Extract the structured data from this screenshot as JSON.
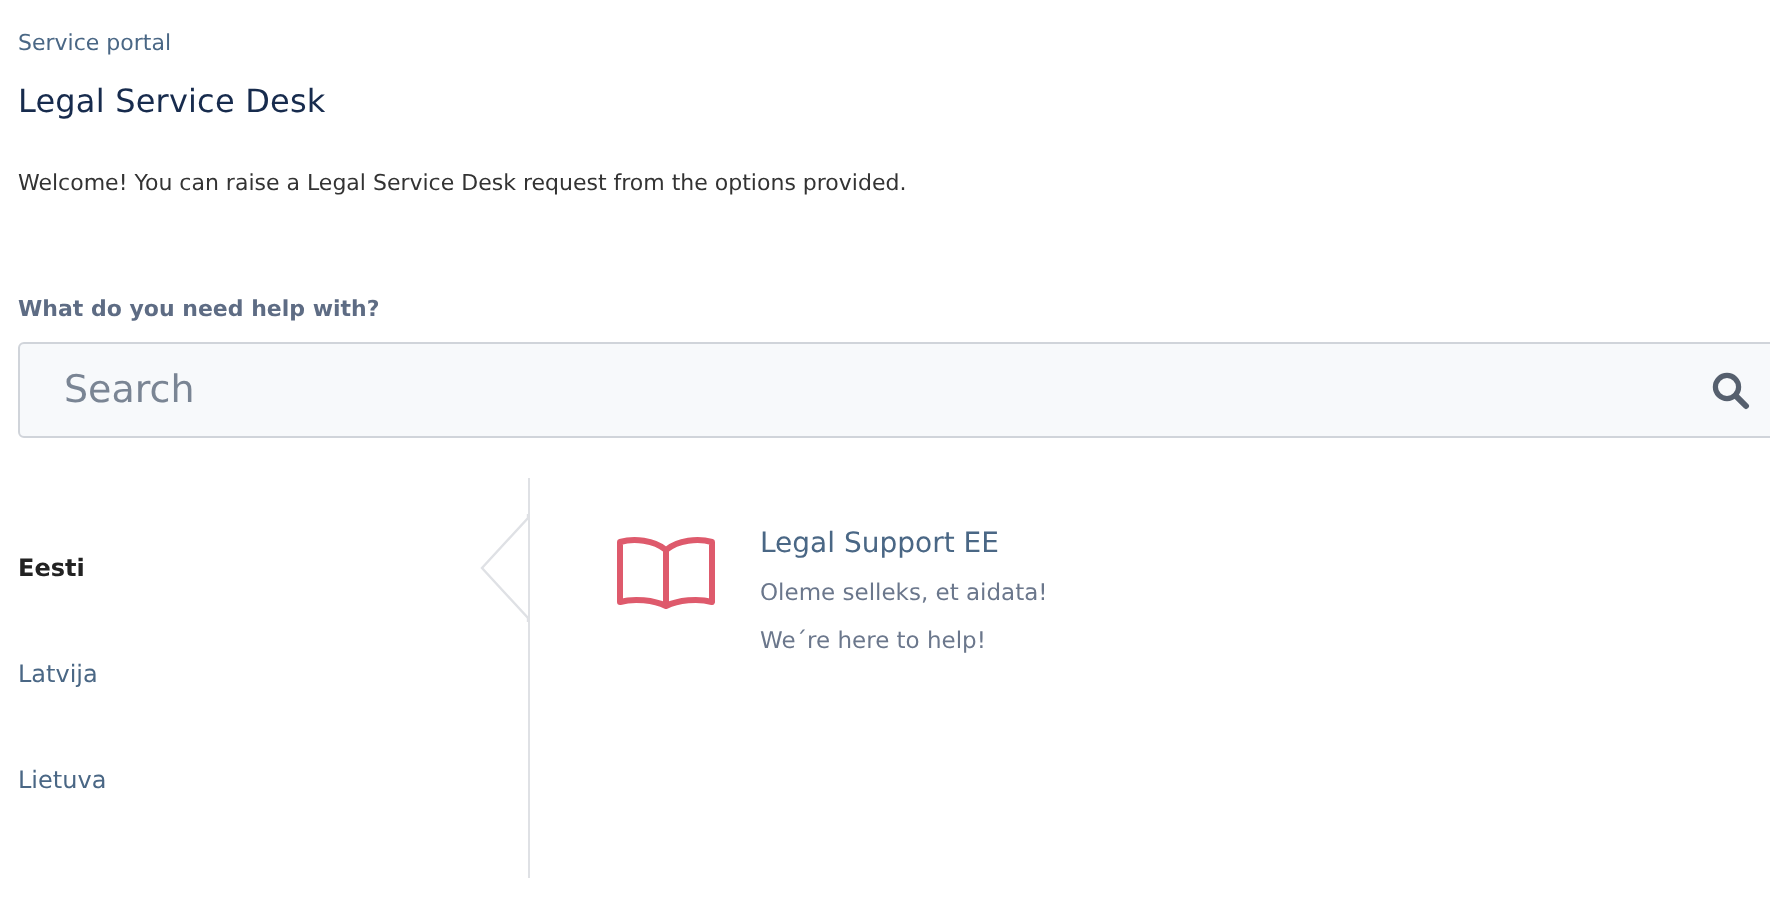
{
  "breadcrumb": "Service portal",
  "title": "Legal Service Desk",
  "welcome": "Welcome! You can raise a Legal Service Desk request from the options provided.",
  "search": {
    "label": "What do you need help with?",
    "placeholder": "Search"
  },
  "sidebar": {
    "items": [
      {
        "label": "Eesti",
        "selected": true
      },
      {
        "label": "Latvija",
        "selected": false
      },
      {
        "label": "Lietuva",
        "selected": false
      }
    ]
  },
  "request_types": [
    {
      "title": "Legal Support EE",
      "lines": [
        "Oleme selleks, et aidata!",
        "We´re here to help!"
      ]
    }
  ]
}
